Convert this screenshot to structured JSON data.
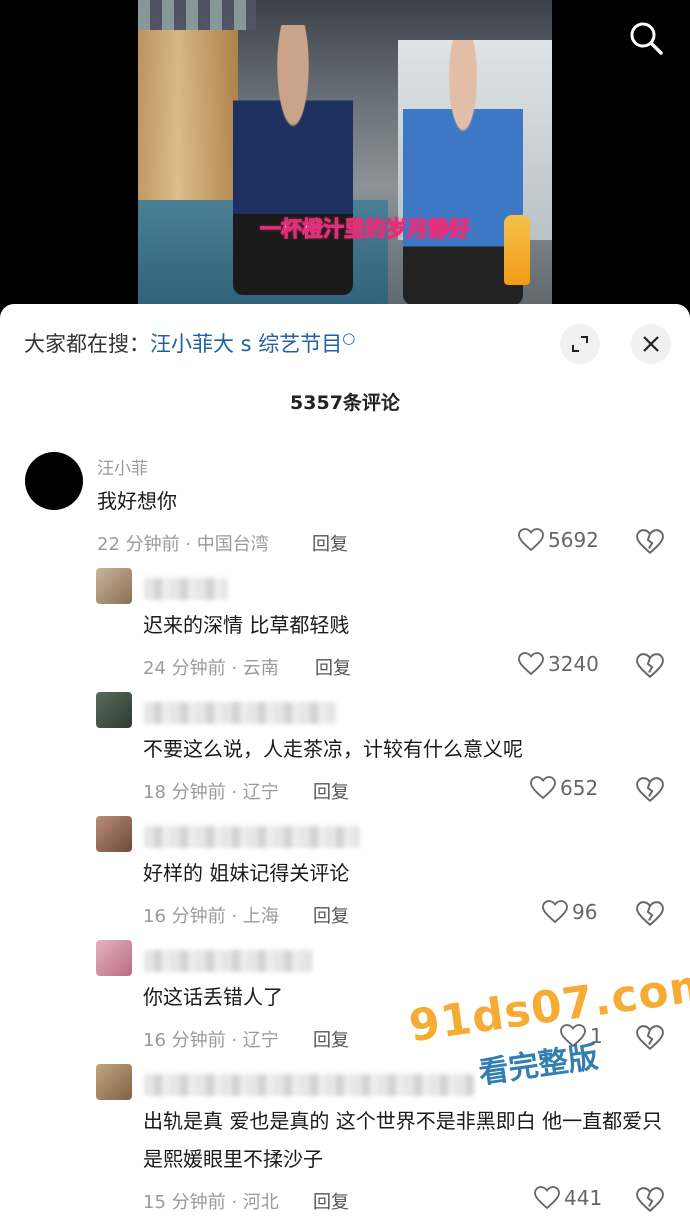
{
  "video": {
    "caption": "一杯橙汁里的岁月静好"
  },
  "sheet": {
    "search_prefix": "大家都在搜：",
    "search_keyword": "汪小菲大 s 综艺节目",
    "comment_count": "5357条评论"
  },
  "comments": [
    {
      "user": "汪小菲",
      "text": "我好想你",
      "time": "22 分钟前 · 中国台湾",
      "reply": "回复",
      "likes": "5692"
    },
    {
      "user": "",
      "text": "迟来的深情  比草都轻贱",
      "time": "24 分钟前 · 云南",
      "reply": "回复",
      "likes": "3240"
    },
    {
      "user": "",
      "text": "不要这么说，人走茶凉，计较有什么意义呢",
      "time": "18 分钟前 · 辽宁",
      "reply": "回复",
      "likes": "652"
    },
    {
      "user": "",
      "text": "好样的 姐妹记得关评论",
      "time": "16 分钟前 · 上海",
      "reply": "回复",
      "likes": "96"
    },
    {
      "user": "",
      "text": "你这话丢错人了",
      "time": "16 分钟前 · 辽宁",
      "reply": "回复",
      "likes": "1"
    },
    {
      "user": "",
      "text": "出轨是真 爱也是真的 这个世界不是非黑即白 他一直都爱只是熙媛眼里不揉沙子",
      "time": "15 分钟前 · 河北",
      "reply": "回复",
      "likes": "441"
    }
  ],
  "watermark": {
    "site": "91ds07.com",
    "slogan": "看完整版"
  }
}
